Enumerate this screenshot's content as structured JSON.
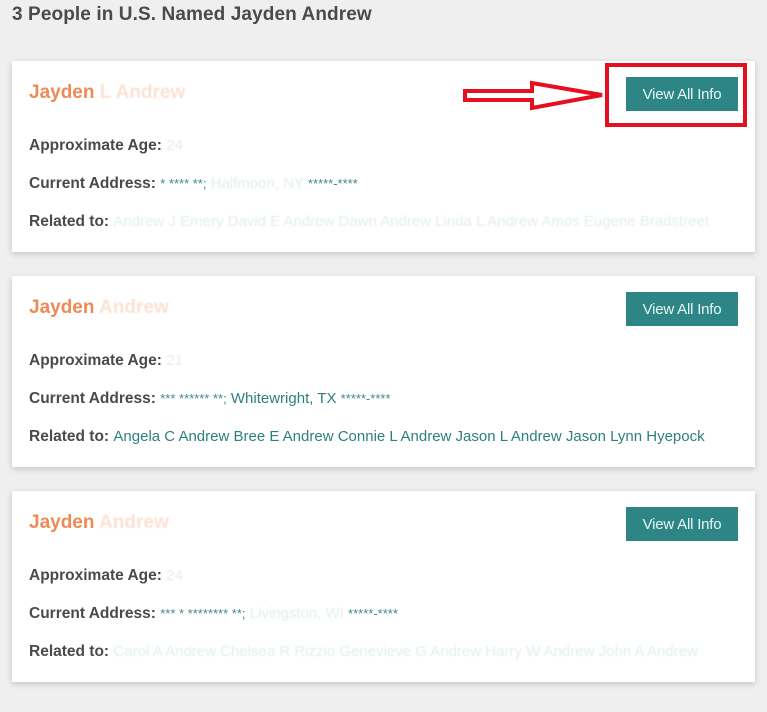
{
  "page": {
    "heading": "3 People in U.S. Named Jayden Andrew"
  },
  "labels": {
    "age": "Approximate Age:",
    "address": "Current Address:",
    "related": "Related to:",
    "view_button": "View All Info"
  },
  "results": [
    {
      "name_visible": "Jayden",
      "name_faded": " L Andrew",
      "age": "24",
      "address_masked_prefix": "* **** **;",
      "address_faded": " Halfmoon, NY ",
      "address_masked_suffix": "*****-****",
      "address_plain": "",
      "related_visible": "",
      "related_faded": "Andrew J Emery David E Andrew Dawn Andrew Linda L Andrew Amos Eugene Bradstreet",
      "highlighted": true
    },
    {
      "name_visible": "Jayden",
      "name_faded": " Andrew",
      "age": "21",
      "address_masked_prefix": "*** ****** **;",
      "address_faded": "",
      "address_plain": " Whitewright, TX ",
      "address_masked_suffix": "*****-****",
      "related_visible": "Angela C Andrew Bree E Andrew Connie L Andrew Jason L Andrew Jason Lynn Hyepock",
      "related_faded": "",
      "highlighted": false
    },
    {
      "name_visible": "Jayden",
      "name_faded": " Andrew",
      "age": "24",
      "address_masked_prefix": "*** * ******** **;",
      "address_faded": " Livingston, WI ",
      "address_plain": "",
      "address_masked_suffix": "*****-****",
      "related_visible": "",
      "related_faded": "Carol A Andrew Chelsea R Rizzio Genevieve G Andrew Harry W Andrew John A Andrew",
      "highlighted": false
    }
  ],
  "annotation": {
    "color": "#e5101f",
    "target": "View All Info"
  },
  "colors": {
    "name_accent": "#ee8a55",
    "button_bg": "#2e8585",
    "link_teal": "#2e7f80",
    "page_bg": "#efefef"
  }
}
